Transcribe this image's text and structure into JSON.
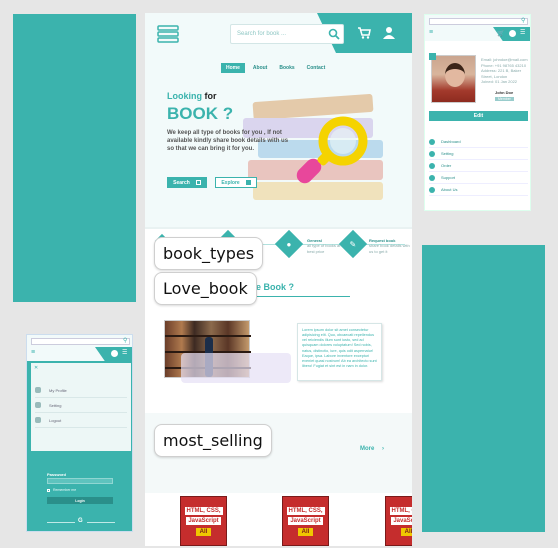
{
  "hero": {
    "search_placeholder": "Search for book ...",
    "nav": [
      "Home",
      "About",
      "Books",
      "Contact"
    ],
    "title_looking": "Looking",
    "title_for": "for",
    "title_book": "BOOK ?",
    "desc": "We keep all type of books for you , If not available kindly share book details with us so that we can bring it for you.",
    "search_btn": "Search",
    "explore_btn": "Explore"
  },
  "labels": {
    "book_types": "book_types",
    "love_book": "Love_book",
    "most_selling": "most_selling"
  },
  "book_types": {
    "items": [
      {
        "title": "General",
        "desc": "all type of books at best price"
      },
      {
        "title": "Request book",
        "desc": "share book details with us to get it"
      }
    ]
  },
  "love_book": {
    "title_suffix": "ve Book ?",
    "text": "Lorem ipsum dolor sit amet consectetur adipisicing elit. Quo, obcaecati repellendus vel reiciendis illum sunt iusto, sed ad quisquam dolores voluptatum! Sed nobis, natus, distinctio, iure, quis odit aspernatur! Eaque, ipsa. Labore inventore excepturi eveniet quasi nostrum! Ab ea architecto sunt libero! Fugiat et sint est in nam in dolor."
  },
  "most_selling": {
    "more": "More",
    "books": [
      {
        "t1": "HTML, CSS,",
        "t2": "JavaScript",
        "badge": "All"
      },
      {
        "t1": "HTML, CSS,",
        "t2": "JavaScript",
        "badge": "All"
      },
      {
        "t1": "HTML, CSS,",
        "t2": "JavaScript",
        "badge": "All"
      }
    ]
  },
  "profile": {
    "name": "John Doe",
    "role": "Member",
    "edit": "Edit",
    "details": [
      "Email: johndoe@mail.com",
      "Phone: +91 98765 43210",
      "Address: 221 B, Baker Street, London",
      "Joined: 01 Jan 2022"
    ],
    "menu": [
      "Dashboard",
      "Setting",
      "Order",
      "Support",
      "About Us"
    ]
  },
  "mobile": {
    "close": "✕",
    "menu": [
      "My Profile",
      "Setting",
      "Logout"
    ],
    "password_label": "Password",
    "remember": "Remember me",
    "login": "Login",
    "google": "G"
  },
  "colors": {
    "accent": "#3bb3ad",
    "dark_accent": "#2a8f8a",
    "magnifier": "#f5d300"
  }
}
